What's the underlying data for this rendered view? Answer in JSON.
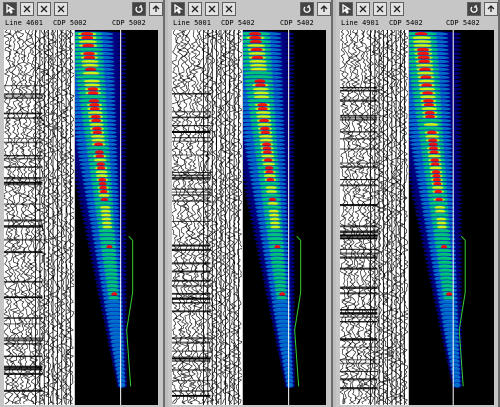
{
  "windows": [
    {
      "id": "w1",
      "label_line": "Line 4601",
      "label_cdp_seis": "CDP 5002",
      "label_cdp_spec": "CDP 5002"
    },
    {
      "id": "w2",
      "label_line": "Line 5001",
      "label_cdp_seis": "CDP 5402",
      "label_cdp_spec": "CDP 5402"
    },
    {
      "id": "w3",
      "label_line": "Line 4901",
      "label_cdp_seis": "CDP 5402",
      "label_cdp_spec": "CDP 5402"
    }
  ],
  "toolbar": {
    "pointer_icon": "pointer-arrow-icon",
    "zoom_icon": "zoom-icon",
    "pan_icon": "pan-icon",
    "cursor_icon": "cursor-icon",
    "refresh_icon": "refresh-icon",
    "up_icon": "up-arrow-icon"
  },
  "colors": {
    "background": "#000000",
    "low": "#0000aa",
    "mid": "#00c8ff",
    "green": "#00ff40",
    "yellow": "#ffff00",
    "red": "#ff0000",
    "trace_line": "#ffffff",
    "pick_line": "#33cc33"
  }
}
